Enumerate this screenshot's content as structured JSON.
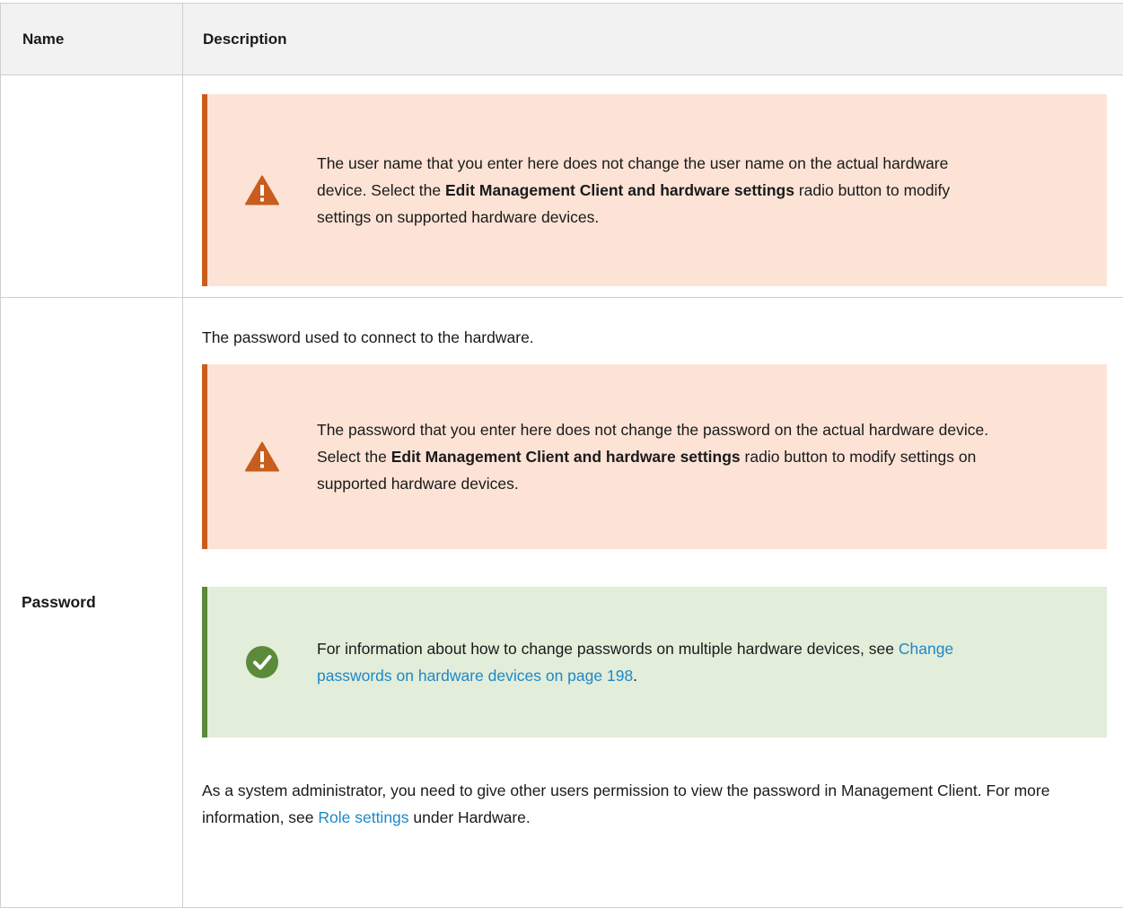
{
  "table": {
    "headers": {
      "name": "Name",
      "description": "Description"
    },
    "rows": [
      {
        "name": "",
        "callouts": [
          {
            "type": "warning",
            "icon": "warning-triangle-icon",
            "text_before": "The user name that you enter here does not change the user name on the actual hardware device. Select the ",
            "bold": "Edit Management Client and hardware settings",
            "text_after": " radio button to modify settings on supported hardware devices."
          }
        ]
      },
      {
        "name": "Password",
        "intro": "The password used to connect to the hardware.",
        "callouts": [
          {
            "type": "warning",
            "icon": "warning-triangle-icon",
            "text_before": "The password that you enter here does not change the password on the actual hardware device. Select the ",
            "bold": "Edit Management Client and hardware settings",
            "text_after": " radio button to modify settings on supported hardware devices."
          },
          {
            "type": "tip",
            "icon": "checkmark-circle-icon",
            "text_before": "For information about how to change passwords on multiple hardware devices, see ",
            "link": "Change passwords on hardware devices on page 198",
            "text_after": "."
          }
        ],
        "footer": {
          "text_before": "As a system administrator, you need to give other users permission to view the password in Management Client. For more information, see ",
          "link": "Role settings",
          "text_after": " under Hardware."
        }
      }
    ]
  },
  "colors": {
    "warning_bg": "#fce3d6",
    "warning_bar": "#c85d1d",
    "tip_bg": "#e2edda",
    "tip_bar": "#5b8a3a",
    "link": "#1e88c8",
    "header_bg": "#f2f2f2"
  }
}
